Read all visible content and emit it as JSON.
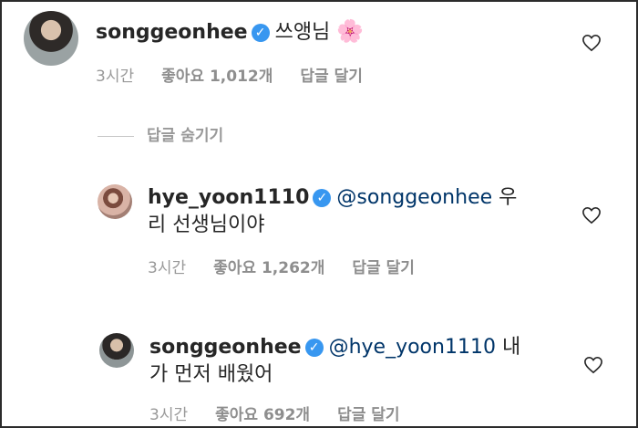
{
  "comments": [
    {
      "username": "songgeonhee",
      "text": "쓰앵님",
      "emoji": "🌸",
      "time": "3시간",
      "likes": "좋아요 1,012개",
      "reply": "답글 달기"
    },
    {
      "username": "hye_yoon1110",
      "mention": "@songgeonhee",
      "text_line1_suffix": "우",
      "text_line2": "리 선생님이야",
      "time": "3시간",
      "likes": "좋아요 1,262개",
      "reply": "답글 달기"
    },
    {
      "username": "songgeonhee",
      "mention": "@hye_yoon1110",
      "text_line1_suffix": "내",
      "text_line2": "가 먼저 배웠어",
      "time": "3시간",
      "likes": "좋아요 692개",
      "reply": "답글 달기"
    }
  ],
  "hide_replies_label": "답글 숨기기",
  "icons": {
    "verified": "verified-badge-icon",
    "heart": "heart-outline-icon"
  },
  "colors": {
    "verified": "#3897f0",
    "mention": "#003569",
    "meta": "#999999"
  }
}
